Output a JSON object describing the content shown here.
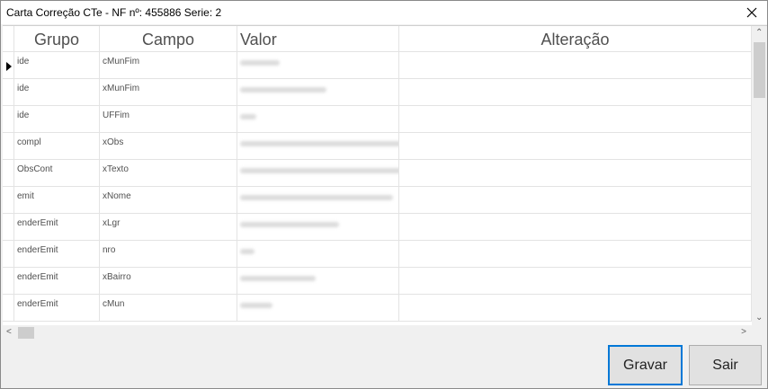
{
  "window": {
    "title": "Carta Correção CTe - NF nº: 455886 Serie: 2"
  },
  "grid": {
    "columns": [
      "Grupo",
      "Campo",
      "Valor",
      "Alteração"
    ],
    "rows": [
      {
        "grupo": "ide",
        "campo": "cMunFim"
      },
      {
        "grupo": "ide",
        "campo": "xMunFim"
      },
      {
        "grupo": "ide",
        "campo": "UFFim"
      },
      {
        "grupo": "compl",
        "campo": "xObs"
      },
      {
        "grupo": "ObsCont",
        "campo": "xTexto"
      },
      {
        "grupo": "emit",
        "campo": "xNome"
      },
      {
        "grupo": "enderEmit",
        "campo": "xLgr"
      },
      {
        "grupo": "enderEmit",
        "campo": "nro"
      },
      {
        "grupo": "enderEmit",
        "campo": "xBairro"
      },
      {
        "grupo": "enderEmit",
        "campo": "cMun"
      }
    ]
  },
  "buttons": {
    "gravar": "Gravar",
    "sair": "Sair"
  },
  "icons": {
    "close": "close-icon",
    "current_row": "row-pointer-icon"
  }
}
